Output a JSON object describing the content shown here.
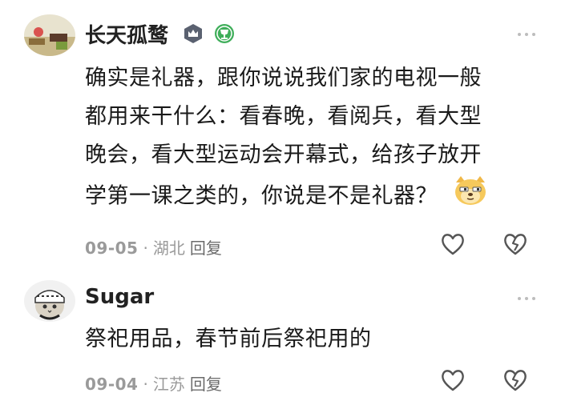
{
  "comments": [
    {
      "username": "长天孤鹜",
      "text_lines": [
        "确实是礼器，跟你说说我们家的电视一般",
        "都用来干什么：看春晚，看阅兵，看大型",
        "晚会，看大型运动会开幕式，给孩子放开",
        "学第一课之类的，你说是不是礼器？"
      ],
      "date": "09-05",
      "location": "湖北",
      "reply_label": "回复"
    },
    {
      "username": "Sugar",
      "text_lines": [
        "祭祀用品，春节前后祭祀用的"
      ],
      "date": "09-04",
      "location": "江苏",
      "reply_label": "回复"
    }
  ],
  "separator": "·",
  "colors": {
    "badge_dark": "#5a6170",
    "badge_green": "#3fae5a",
    "meta_gray": "#9a9a9a"
  },
  "icons": [
    "crown-badge-icon",
    "trophy-badge-icon",
    "heart-outline-icon",
    "broken-heart-outline-icon",
    "more-dots-icon",
    "doge-emoji-icon"
  ]
}
